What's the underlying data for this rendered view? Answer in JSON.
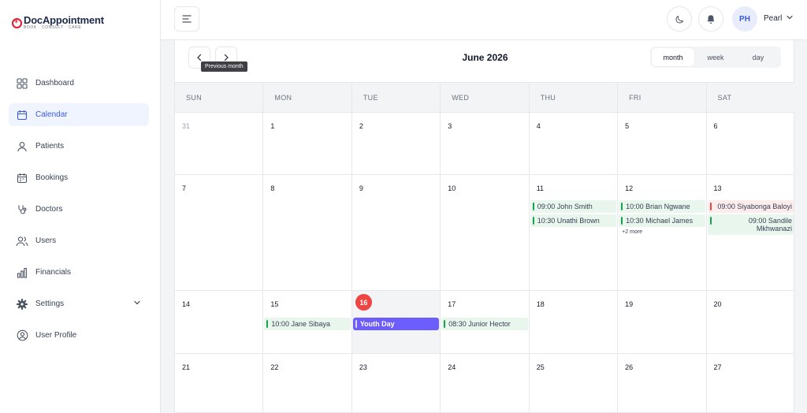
{
  "brand": {
    "name_part1": "Doc",
    "name_part2": "Appointment",
    "tagline": "BOOK · CONSULT · CARE"
  },
  "sidebar": {
    "items": [
      {
        "label": "Dashboard",
        "icon": "grid-icon"
      },
      {
        "label": "Calendar",
        "icon": "calendar-icon",
        "active": true
      },
      {
        "label": "Patients",
        "icon": "user-icon"
      },
      {
        "label": "Bookings",
        "icon": "calendar-check-icon"
      },
      {
        "label": "Doctors",
        "icon": "stethoscope-icon"
      },
      {
        "label": "Users",
        "icon": "users-icon"
      },
      {
        "label": "Financials",
        "icon": "bar-chart-icon"
      },
      {
        "label": "Settings",
        "icon": "gear-icon",
        "has_submenu": true
      },
      {
        "label": "User Profile",
        "icon": "user-circle-icon"
      }
    ]
  },
  "header": {
    "user_initials": "PH",
    "user_name": "Pearl"
  },
  "calendar": {
    "title": "June 2026",
    "prev_tooltip": "Previous month",
    "views": [
      "month",
      "week",
      "day"
    ],
    "active_view": "month",
    "weekdays": [
      "SUN",
      "MON",
      "TUE",
      "WED",
      "THU",
      "FRI",
      "SAT"
    ],
    "weeks": [
      {
        "days": [
          {
            "date": "31",
            "muted": true,
            "events": []
          },
          {
            "date": "1",
            "events": []
          },
          {
            "date": "2",
            "events": []
          },
          {
            "date": "3",
            "events": []
          },
          {
            "date": "4",
            "events": []
          },
          {
            "date": "5",
            "events": []
          },
          {
            "date": "6",
            "events": []
          }
        ]
      },
      {
        "days": [
          {
            "date": "7",
            "events": []
          },
          {
            "date": "8",
            "events": []
          },
          {
            "date": "9",
            "events": []
          },
          {
            "date": "10",
            "events": []
          },
          {
            "date": "11",
            "events": [
              {
                "text": "09:00 John Smith",
                "status": "green"
              },
              {
                "text": "10:30 Unathi Brown",
                "status": "green"
              }
            ]
          },
          {
            "date": "12",
            "events": [
              {
                "text": "10:00 Brian Ngwane",
                "status": "green"
              },
              {
                "text": "10:30 Michael James",
                "status": "green"
              }
            ],
            "more": "+2 more"
          },
          {
            "date": "13",
            "events": [
              {
                "text": "09:00 Siyabonga Baloyi",
                "status": "red"
              },
              {
                "text": "09:00 Sandile Mkhwanazi",
                "status": "green"
              }
            ]
          }
        ]
      },
      {
        "days": [
          {
            "date": "14",
            "events": []
          },
          {
            "date": "15",
            "events": [
              {
                "text": "10:00 Jane Sibaya",
                "status": "green"
              }
            ]
          },
          {
            "date": "16",
            "today": true,
            "events": [
              {
                "text": "Youth Day",
                "status": "holiday"
              }
            ]
          },
          {
            "date": "17",
            "events": [
              {
                "text": "08:30 Junior Hector",
                "status": "green"
              }
            ]
          },
          {
            "date": "18",
            "events": []
          },
          {
            "date": "19",
            "events": []
          },
          {
            "date": "20",
            "events": []
          }
        ]
      },
      {
        "days": [
          {
            "date": "21",
            "events": []
          },
          {
            "date": "22",
            "events": []
          },
          {
            "date": "23",
            "events": []
          },
          {
            "date": "24",
            "events": []
          },
          {
            "date": "25",
            "events": []
          },
          {
            "date": "26",
            "events": []
          },
          {
            "date": "27",
            "events": []
          }
        ]
      }
    ]
  },
  "colors": {
    "accent": "#3b5bdb",
    "today": "#ef4444",
    "holiday": "#6d5dfc",
    "confirmed": "#16a34a",
    "cancelled": "#ef4444"
  }
}
